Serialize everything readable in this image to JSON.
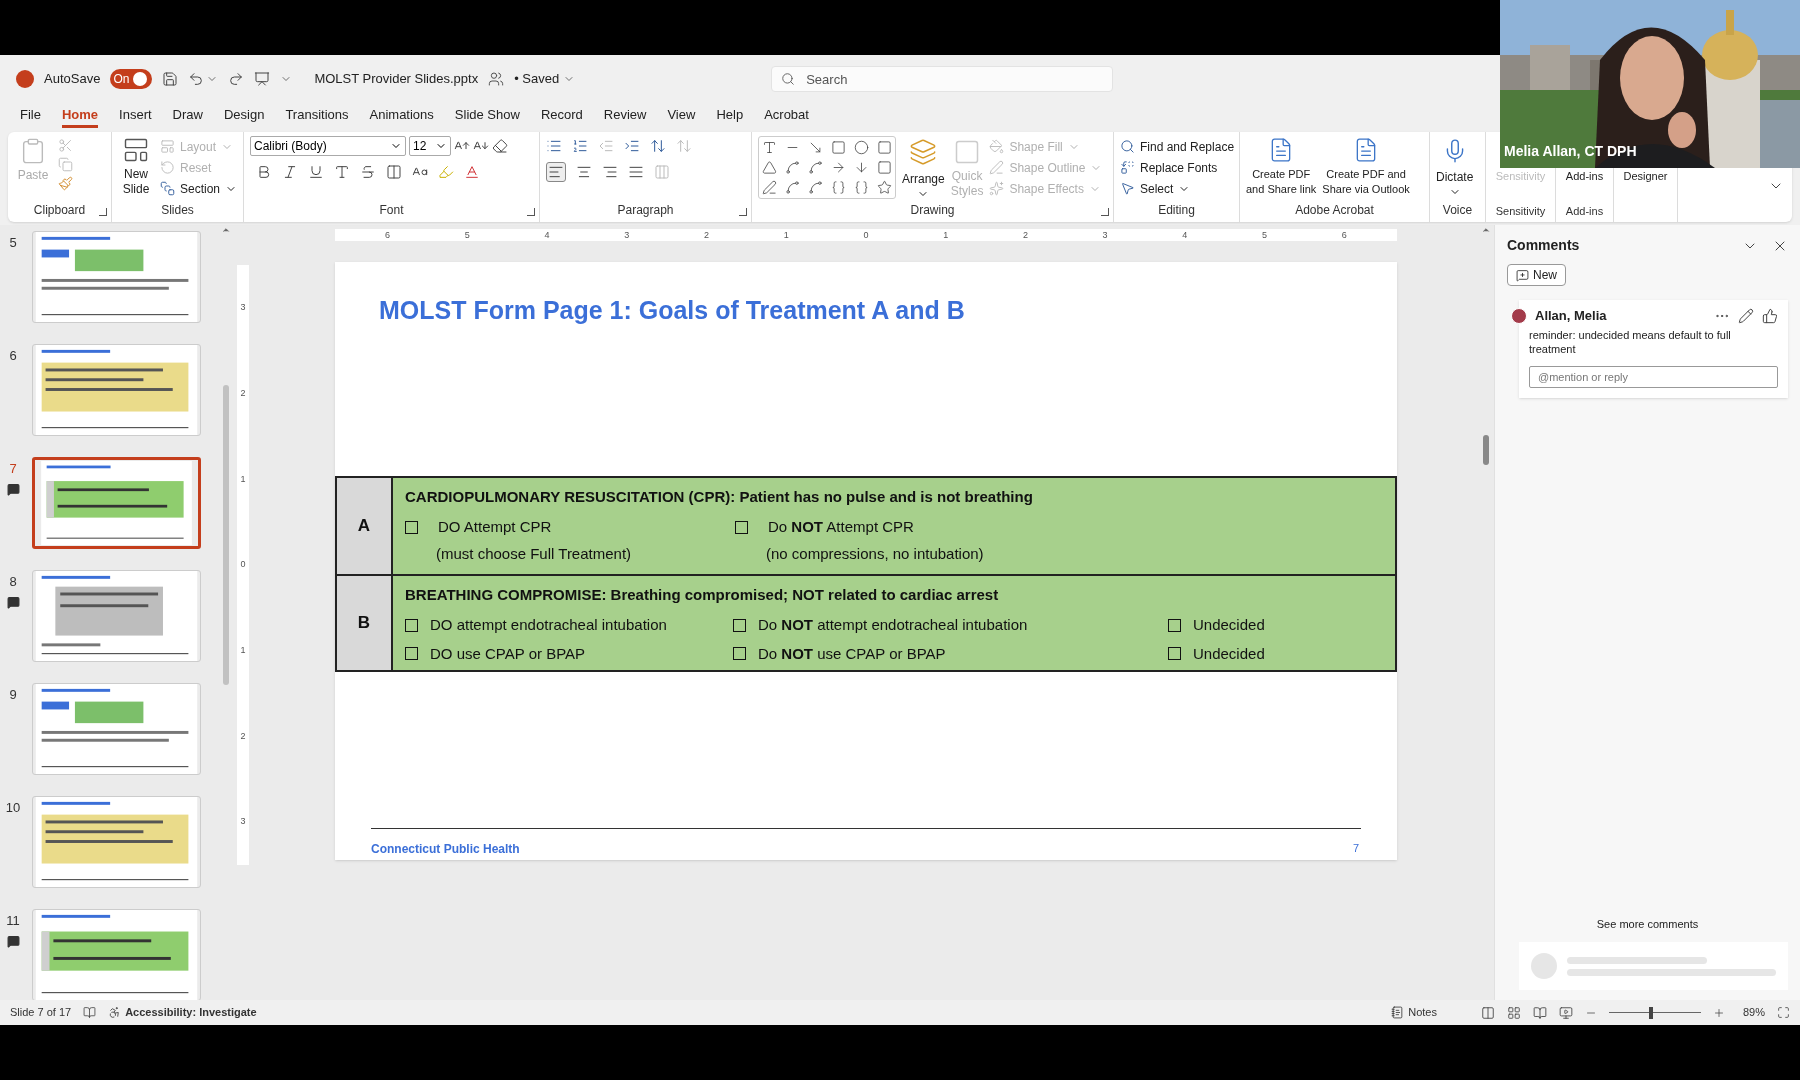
{
  "title_bar": {
    "autosave_label": "AutoSave",
    "autosave": {
      "on": true,
      "label": "On"
    },
    "filename": "MOLST Provider Slides.pptx",
    "save_status": "• Saved",
    "search_placeholder": "Search"
  },
  "menu_tabs": [
    {
      "label": "File",
      "selected": false
    },
    {
      "label": "Home",
      "selected": true
    },
    {
      "label": "Insert",
      "selected": false
    },
    {
      "label": "Draw",
      "selected": false
    },
    {
      "label": "Design",
      "selected": false
    },
    {
      "label": "Transitions",
      "selected": false
    },
    {
      "label": "Animations",
      "selected": false
    },
    {
      "label": "Slide Show",
      "selected": false
    },
    {
      "label": "Record",
      "selected": false
    },
    {
      "label": "Review",
      "selected": false
    },
    {
      "label": "View",
      "selected": false
    },
    {
      "label": "Help",
      "selected": false
    },
    {
      "label": "Acrobat",
      "selected": false
    }
  ],
  "ribbon": {
    "clipboard": {
      "paste": {
        "label": "Paste",
        "disabled": true
      },
      "group_label": "Clipboard"
    },
    "slides": {
      "new_slide": [
        "New",
        "Slide"
      ],
      "layout": {
        "label": "Layout",
        "disabled": true
      },
      "reset": {
        "label": "Reset",
        "disabled": true
      },
      "section": {
        "label": "Section",
        "disabled": false
      },
      "group_label": "Slides"
    },
    "font": {
      "font_name": "Calibri (Body)",
      "font_size": "12",
      "group_label": "Font"
    },
    "paragraph": {
      "group_label": "Paragraph"
    },
    "drawing": {
      "arrange": "Arrange",
      "quick_styles": {
        "lines": [
          "Quick",
          "Styles"
        ],
        "disabled": true
      },
      "shape_fill": {
        "label": "Shape Fill",
        "disabled": true
      },
      "shape_outline": {
        "label": "Shape Outline",
        "disabled": true
      },
      "shape_effects": {
        "label": "Shape Effects",
        "disabled": true
      },
      "group_label": "Drawing"
    },
    "editing": {
      "find_replace": "Find and Replace",
      "replace_fonts": "Replace Fonts",
      "select": "Select",
      "group_label": "Editing"
    },
    "adobe_acrobat": {
      "share_link": [
        "Create PDF",
        "and Share link"
      ],
      "share_outlook": [
        "Create PDF and",
        "Share via Outlook"
      ],
      "group_label": "Adobe Acrobat"
    },
    "voice": {
      "dictate": "Dictate",
      "group_label": "Voice"
    },
    "sensitivity": {
      "button": {
        "label": "Sensitivity",
        "disabled": true
      },
      "group_label": "Sensitivity"
    },
    "add_ins": {
      "button": "Add-ins",
      "group_label": "Add-ins"
    },
    "designer": {
      "button": "Designer"
    }
  },
  "webcam": {
    "caption": "Melia Allan, CT DPH"
  },
  "slide_panel": {
    "thumbnails": [
      {
        "number": "5",
        "selected": false,
        "has_comment": false
      },
      {
        "number": "6",
        "selected": false,
        "has_comment": false
      },
      {
        "number": "7",
        "selected": true,
        "has_comment": true
      },
      {
        "number": "8",
        "selected": false,
        "has_comment": true
      },
      {
        "number": "9",
        "selected": false,
        "has_comment": false
      },
      {
        "number": "10",
        "selected": false,
        "has_comment": false
      },
      {
        "number": "11",
        "selected": false,
        "has_comment": true
      }
    ]
  },
  "ruler": {
    "horizontal": [
      "6",
      "5",
      "4",
      "3",
      "2",
      "1",
      "0",
      "1",
      "2",
      "3",
      "4",
      "5",
      "6"
    ],
    "vertical": [
      "3",
      "2",
      "1",
      "0",
      "1",
      "2",
      "3"
    ]
  },
  "slide": {
    "title": "MOLST Form Page 1: Goals of Treatment A and B",
    "sections": [
      {
        "letter": "A",
        "heading": "CARDIOPULMONARY RESUSCITATION (CPR): Patient has no pulse and is not breathing",
        "kind": "pairs",
        "options": [
          {
            "text": "DO Attempt CPR",
            "note": "(must choose Full Treatment)",
            "checked": false
          },
          {
            "text": "Do **NOT** Attempt CPR",
            "note": "(no compressions, no intubation)",
            "checked": false
          }
        ]
      },
      {
        "letter": "B",
        "heading": "BREATHING COMPROMISE: Breathing compromised; NOT related to cardiac arrest",
        "kind": "grid",
        "rows": [
          [
            {
              "text": "DO attempt endotracheal intubation",
              "checked": false
            },
            {
              "text": "Do **NOT** attempt endotracheal intubation",
              "checked": false
            },
            {
              "text": "Undecided",
              "checked": false
            }
          ],
          [
            {
              "text": "DO use CPAP or BPAP",
              "checked": false
            },
            {
              "text": "Do **NOT** use CPAP or BPAP",
              "checked": false
            },
            {
              "text": "Undecided",
              "checked": false
            }
          ]
        ]
      }
    ],
    "footer": "Connecticut Public Health",
    "page_number": "7"
  },
  "comments_panel": {
    "title": "Comments",
    "new_button": "New",
    "comments": [
      {
        "author": "Allan, Melia",
        "text": "reminder: undecided means default to full treatment",
        "reply_placeholder": "@mention or reply"
      }
    ],
    "see_more": "See more comments"
  },
  "status_bar": {
    "slide_info": "Slide 7 of 17",
    "accessibility": "Accessibility: Investigate",
    "notes": "Notes",
    "zoom": {
      "level": 0.46,
      "label": "89%"
    }
  }
}
